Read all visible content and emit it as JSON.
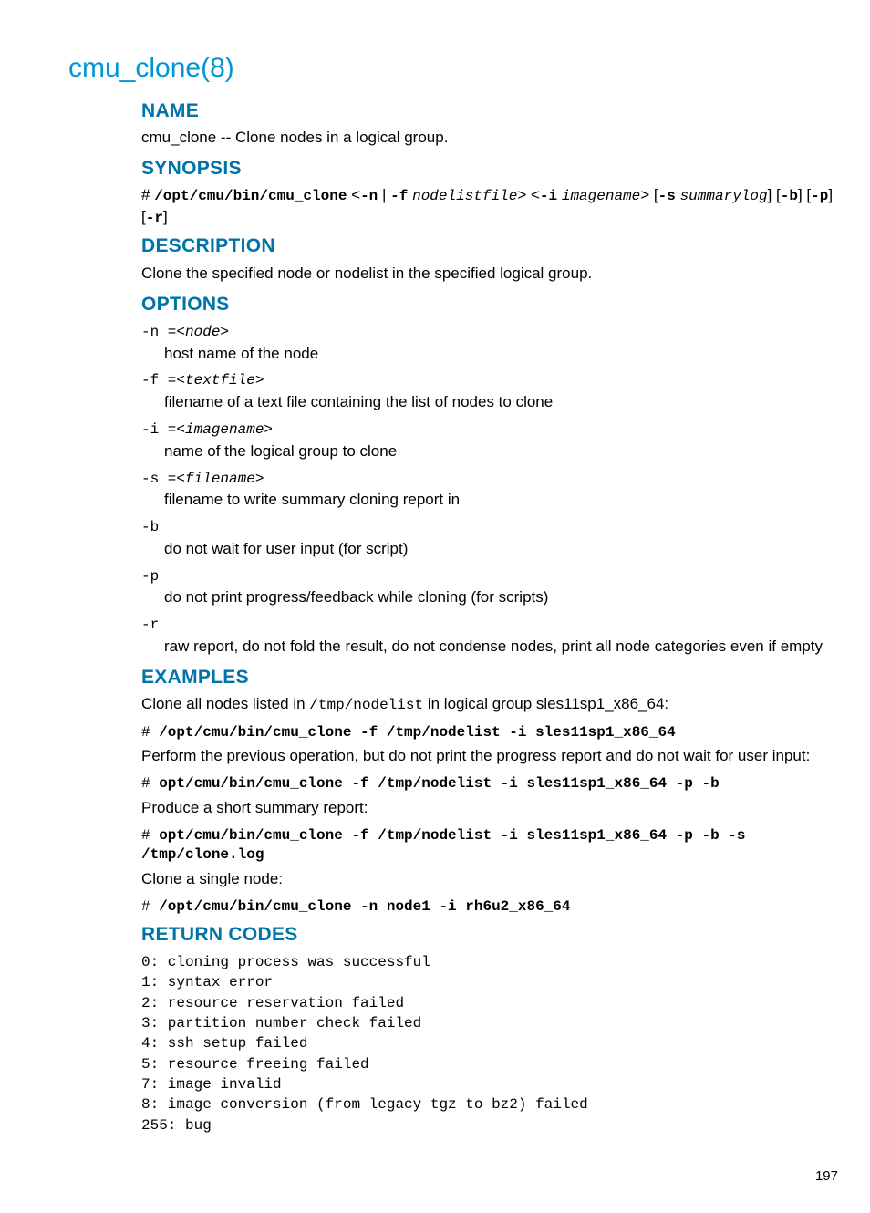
{
  "page_title": "cmu_clone(8)",
  "sections": {
    "name": {
      "heading": "NAME",
      "text": "cmu_clone -- Clone nodes in a logical group."
    },
    "synopsis": {
      "heading": "SYNOPSIS",
      "prefix": "# ",
      "cmd": "/opt/cmu/bin/cmu_clone",
      "parts": {
        "lt1": " <",
        "n": "-n",
        "pipe": " | ",
        "f": "-f",
        "sp1": " ",
        "nodelistfile": "nodelistfile",
        "gt1": "> <",
        "i": "-i",
        "sp2": " ",
        "imagename": "imagename",
        "gt2": "> [",
        "s": "-s",
        "sp3": " ",
        "summarylog": "summarylog",
        "rb1": "] [",
        "b": "-b",
        "rb2": "] [",
        "p": "-p",
        "rb3": "] [",
        "r": "-r",
        "rb4": "]"
      }
    },
    "description": {
      "heading": "DESCRIPTION",
      "text": "Clone the specified node or nodelist in the specified logical group."
    },
    "options": {
      "heading": "OPTIONS",
      "items": [
        {
          "flag": "-n =",
          "arg": "<node>",
          "desc": "host name of the node"
        },
        {
          "flag": "-f =",
          "arg": "<textfile>",
          "desc": "filename of a text file containing the list of nodes to clone"
        },
        {
          "flag": "-i =",
          "arg": "<imagename>",
          "desc": "name of the logical group to clone"
        },
        {
          "flag": "-s =",
          "arg": "<filename>",
          "desc": "filename to write summary cloning report in"
        },
        {
          "flag": "-b",
          "arg": "",
          "desc": "do not wait for user input (for script)"
        },
        {
          "flag": "-p",
          "arg": "",
          "desc": "do not print progress/feedback while cloning (for scripts)"
        },
        {
          "flag": "-r",
          "arg": "",
          "desc": "raw report, do not fold the result, do not condense nodes, print all node categories even if empty"
        }
      ]
    },
    "examples": {
      "heading": "EXAMPLES",
      "ex1_intro_a": "Clone all nodes listed in ",
      "ex1_intro_code": "/tmp/nodelist",
      "ex1_intro_b": " in logical group sles11sp1_x86_64:",
      "ex1_cmd_prefix": "# ",
      "ex1_cmd": "/opt/cmu/bin/cmu_clone -f /tmp/nodelist -i sles11sp1_x86_64",
      "ex2_intro": "Perform the previous operation, but do not print the progress report and do not wait for user input:",
      "ex2_cmd_prefix": "# ",
      "ex2_cmd": "opt/cmu/bin/cmu_clone -f /tmp/nodelist -i sles11sp1_x86_64 -p -b",
      "ex3_intro": "Produce a short summary report:",
      "ex3_cmd_prefix": "# ",
      "ex3_cmd": "opt/cmu/bin/cmu_clone -f /tmp/nodelist -i sles11sp1_x86_64 -p -b -s /tmp/clone.log",
      "ex4_intro": "Clone a single node:",
      "ex4_cmd_prefix": "# ",
      "ex4_cmd": "/opt/cmu/bin/cmu_clone -n node1 -i rh6u2_x86_64"
    },
    "return_codes": {
      "heading": "RETURN CODES",
      "lines": "0: cloning process was successful\n1: syntax error\n2: resource reservation failed\n3: partition number check failed\n4: ssh setup failed\n5: resource freeing failed\n7: image invalid\n8: image conversion (from legacy tgz to bz2) failed\n255: bug"
    }
  },
  "page_number": "197"
}
